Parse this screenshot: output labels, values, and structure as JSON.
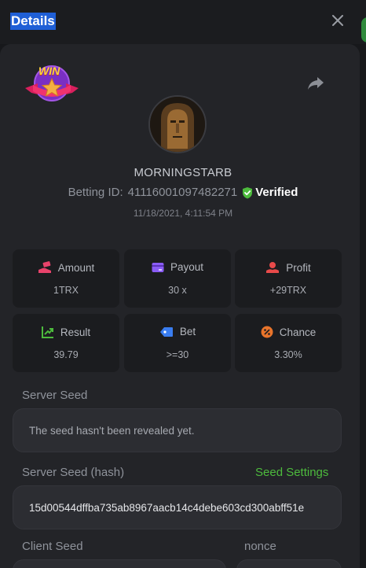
{
  "header": {
    "title": "Details"
  },
  "user": {
    "username": "MORNINGSTARB",
    "betting_id_label": "Betting ID:",
    "betting_id": "411160010974822​71",
    "verified_label": "Verified",
    "timestamp": "11/18/2021, 4:11:54 PM"
  },
  "badge": {
    "text": "WIN"
  },
  "stats": [
    {
      "label": "Amount",
      "value": "1TRX",
      "icon": "money-hand-icon",
      "color": "#e8436b"
    },
    {
      "label": "Payout",
      "value": "30 x",
      "icon": "card-icon",
      "color": "#8a5cf5"
    },
    {
      "label": "Profit",
      "value": "+29TRX",
      "icon": "coins-hand-icon",
      "color": "#e84a4a"
    },
    {
      "label": "Result",
      "value": "39.79",
      "icon": "chart-icon",
      "color": "#4dbb3d"
    },
    {
      "label": "Bet",
      "value": ">=30",
      "icon": "tag-icon",
      "color": "#3a7df0"
    },
    {
      "label": "Chance",
      "value": "3.30%",
      "icon": "percent-icon",
      "color": "#e8742b"
    }
  ],
  "server_seed": {
    "label": "Server Seed",
    "value": "The seed hasn't been revealed yet."
  },
  "server_seed_hash": {
    "label": "Server Seed (hash)",
    "settings_link": "Seed Settings",
    "value": "15d00544dffba735ab8967aacb14c4debe603cd300abff51e"
  },
  "client_seed": {
    "label": "Client Seed"
  },
  "nonce": {
    "label": "nonce"
  },
  "colors": {
    "accent_green": "#4dbb3d",
    "title_highlight": "#1f5fd6",
    "panel": "#232428",
    "card": "#1b1c1f"
  }
}
